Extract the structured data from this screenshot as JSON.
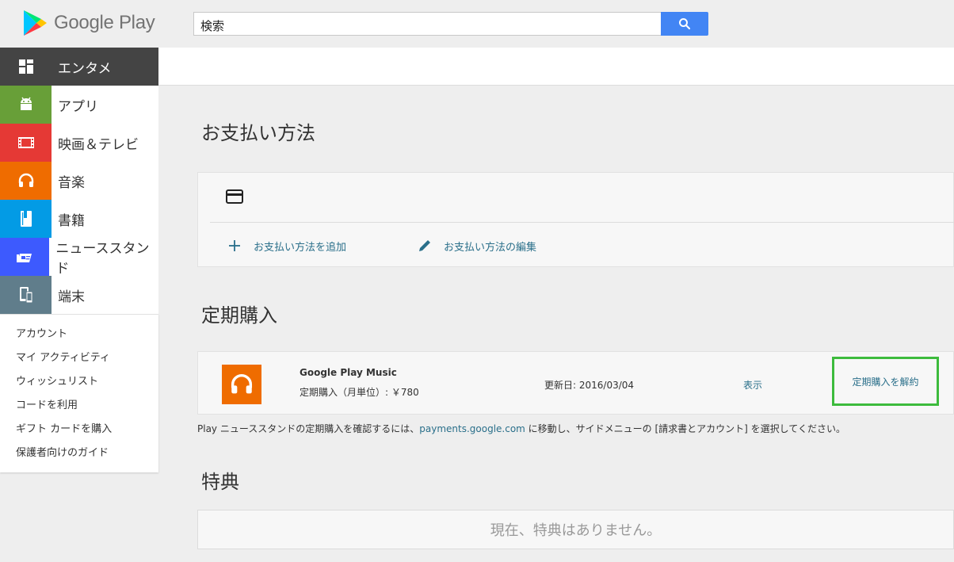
{
  "header": {
    "logo_text": "Google Play",
    "search_value": "検索",
    "colors": {
      "search_button": "#4285f4"
    }
  },
  "sidebar": {
    "categories": [
      {
        "label": "エンタメ",
        "icon": "grid-icon",
        "color": "#444444"
      },
      {
        "label": "アプリ",
        "icon": "android-icon",
        "color": "#689f38"
      },
      {
        "label": "映画＆テレビ",
        "icon": "film-icon",
        "color": "#e53935"
      },
      {
        "label": "音楽",
        "icon": "headphones-icon",
        "color": "#ef6c00"
      },
      {
        "label": "書籍",
        "icon": "book-icon",
        "color": "#039be5"
      },
      {
        "label": "ニューススタンド",
        "icon": "newsstand-icon",
        "color": "#3d5afe"
      },
      {
        "label": "端末",
        "icon": "device-icon",
        "color": "#607d8b"
      }
    ],
    "links": [
      "アカウント",
      "マイ アクティビティ",
      "ウィッシュリスト",
      "コードを利用",
      "ギフト カードを購入",
      "保護者向けのガイド"
    ]
  },
  "payment": {
    "title": "お支払い方法",
    "add_label": "お支払い方法を追加",
    "edit_label": "お支払い方法の編集"
  },
  "subscriptions": {
    "title": "定期購入",
    "item": {
      "name": "Google Play Music",
      "price": "定期購入（月単位）: ￥780",
      "renewal": "更新日: 2016/03/04",
      "view_label": "表示",
      "cancel_label": "定期購入を解約"
    },
    "note_before": "Play ニューススタンドの定期購入を確認するには、",
    "note_link": "payments.google.com",
    "note_after": " に移動し、サイドメニューの [請求書とアカウント] を選択してください。"
  },
  "rewards": {
    "title": "特典",
    "empty_text": "現在、特典はありません。"
  }
}
